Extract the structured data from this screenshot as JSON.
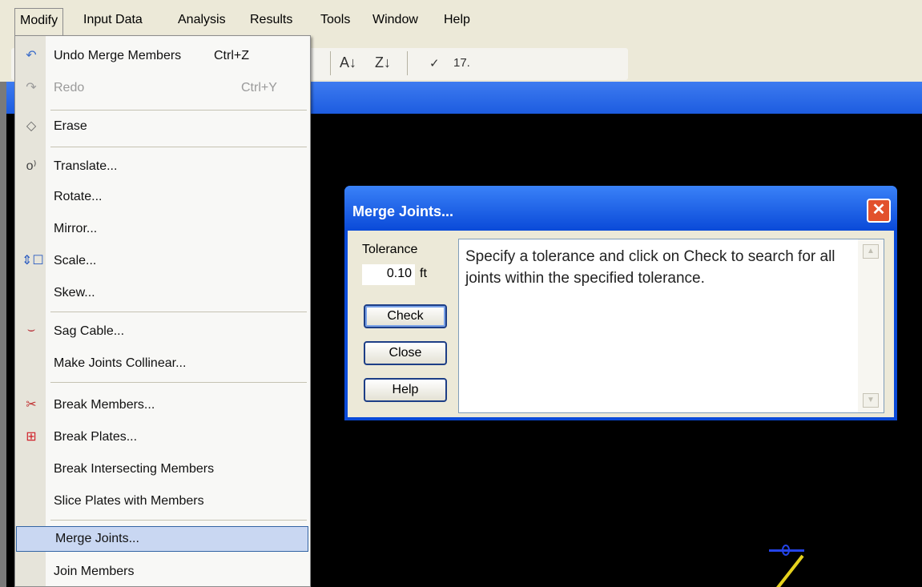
{
  "menubar": {
    "items": [
      "Modify",
      "Input Data",
      "Analysis",
      "Results",
      "Tools",
      "Window",
      "Help"
    ]
  },
  "toolbar": {
    "sort_asc_icon": "sort-az-icon",
    "sort_desc_icon": "sort-za-icon",
    "check_mark": "✓",
    "value_text": "17."
  },
  "modify_menu": {
    "items": [
      {
        "label": "Undo Merge Members",
        "shortcut": "Ctrl+Z",
        "icon": "undo-icon"
      },
      {
        "label": "Redo",
        "shortcut": "Ctrl+Y",
        "icon": "redo-icon"
      },
      {
        "label": "Erase",
        "icon": "eraser-icon"
      },
      {
        "label": "Translate...",
        "icon": "translate-icon"
      },
      {
        "label": "Rotate..."
      },
      {
        "label": "Mirror..."
      },
      {
        "label": "Scale...",
        "icon": "scale-icon"
      },
      {
        "label": "Skew..."
      },
      {
        "label": "Sag Cable...",
        "icon": "sag-cable-icon"
      },
      {
        "label": "Make Joints Collinear..."
      },
      {
        "label": "Break Members...",
        "icon": "break-members-icon"
      },
      {
        "label": "Break Plates...",
        "icon": "break-plates-icon"
      },
      {
        "label": "Break Intersecting Members"
      },
      {
        "label": "Slice Plates with Members"
      },
      {
        "label": "Merge Joints..."
      },
      {
        "label": "Join Members"
      }
    ]
  },
  "dialog": {
    "title": "Merge Joints...",
    "tolerance_label": "Tolerance",
    "tolerance_value": "0.10",
    "tolerance_unit": "ft",
    "check_button": "Check",
    "close_button": "Close",
    "help_button": "Help",
    "message": "Specify a tolerance and click on Check to search for all joints within the specified tolerance."
  },
  "colors": {
    "title_blue": "#0a4ad8",
    "canvas": "#000000",
    "close_red": "#e2512c",
    "highlight": "#c9d7f2"
  }
}
